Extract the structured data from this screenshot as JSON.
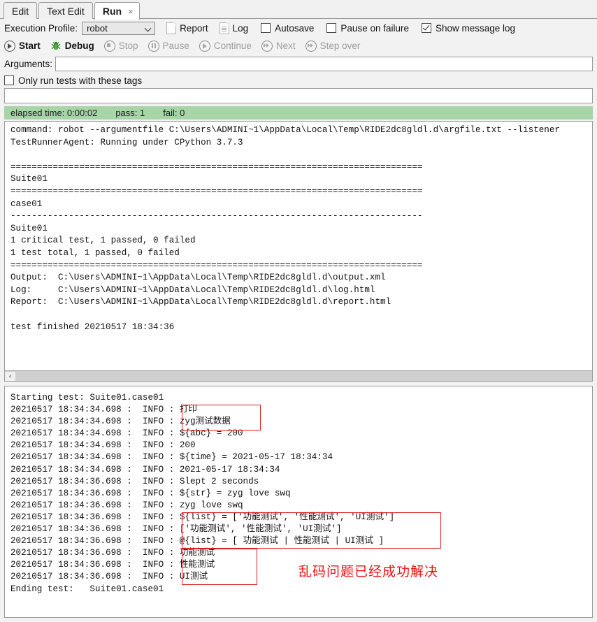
{
  "tabs": [
    {
      "label": "Edit",
      "active": false
    },
    {
      "label": "Text Edit",
      "active": false
    },
    {
      "label": "Run",
      "active": true,
      "close": "×"
    }
  ],
  "toolbar": {
    "execution_profile_label": "Execution Profile:",
    "profile_value": "robot",
    "report_label": "Report",
    "log_label": "Log",
    "autosave_label": "Autosave",
    "autosave_checked": false,
    "pause_on_failure_label": "Pause on failure",
    "pause_on_failure_checked": false,
    "show_message_log_label": "Show message log",
    "show_message_log_checked": true
  },
  "run_controls": [
    {
      "label": "Start",
      "enabled": true,
      "icon": "play-icon"
    },
    {
      "label": "Debug",
      "enabled": true,
      "icon": "bug-icon"
    },
    {
      "label": "Stop",
      "enabled": false,
      "icon": "stop-icon"
    },
    {
      "label": "Pause",
      "enabled": false,
      "icon": "pause-icon"
    },
    {
      "label": "Continue",
      "enabled": false,
      "icon": "play-icon"
    },
    {
      "label": "Next",
      "enabled": false,
      "icon": "next-icon"
    },
    {
      "label": "Step over",
      "enabled": false,
      "icon": "step-over-icon"
    }
  ],
  "arguments": {
    "label": "Arguments:",
    "value": "",
    "placeholder": ""
  },
  "tags": {
    "label": "Only run tests with these tags",
    "checked": false,
    "value": "",
    "placeholder": ""
  },
  "status": {
    "elapsed": "elapsed time: 0:00:02",
    "pass": "pass: 1",
    "fail": "fail: 0",
    "background_color": "#a8d5a8"
  },
  "console": {
    "lines": [
      "command: robot --argumentfile C:\\Users\\ADMINI~1\\AppData\\Local\\Temp\\RIDE2dc8gldl.d\\argfile.txt --listener",
      "TestRunnerAgent: Running under CPython 3.7.3",
      "",
      "==============================================================================",
      "Suite01",
      "==============================================================================",
      "case01",
      "------------------------------------------------------------------------------",
      "Suite01",
      "1 critical test, 1 passed, 0 failed",
      "1 test total, 1 passed, 0 failed",
      "==============================================================================",
      "Output:  C:\\Users\\ADMINI~1\\AppData\\Local\\Temp\\RIDE2dc8gldl.d\\output.xml",
      "Log:     C:\\Users\\ADMINI~1\\AppData\\Local\\Temp\\RIDE2dc8gldl.d\\log.html",
      "Report:  C:\\Users\\ADMINI~1\\AppData\\Local\\Temp\\RIDE2dc8gldl.d\\report.html",
      "",
      "test finished 20210517 18:34:36"
    ]
  },
  "message_log": {
    "lines": [
      "Starting test: Suite01.case01",
      "20210517 18:34:34.698 :  INFO : 打印",
      "20210517 18:34:34.698 :  INFO : zyg测试数据",
      "20210517 18:34:34.698 :  INFO : ${abc} = 200",
      "20210517 18:34:34.698 :  INFO : 200",
      "20210517 18:34:34.698 :  INFO : ${time} = 2021-05-17 18:34:34",
      "20210517 18:34:34.698 :  INFO : 2021-05-17 18:34:34",
      "20210517 18:34:36.698 :  INFO : Slept 2 seconds",
      "20210517 18:34:36.698 :  INFO : ${str} = zyg love swq",
      "20210517 18:34:36.698 :  INFO : zyg love swq",
      "20210517 18:34:36.698 :  INFO : ${list} = ['功能测试', '性能测试', 'UI测试']",
      "20210517 18:34:36.698 :  INFO : ['功能测试', '性能测试', 'UI测试']",
      "20210517 18:34:36.698 :  INFO : @{list} = [ 功能测试 | 性能测试 | UI测试 ]",
      "20210517 18:34:36.698 :  INFO : 功能测试",
      "20210517 18:34:36.698 :  INFO : 性能测试",
      "20210517 18:34:36.698 :  INFO : UI测试",
      "Ending test:   Suite01.case01"
    ],
    "annotation": "乱码问题已经成功解决",
    "annotation_color": "#ee1111",
    "highlight_color": "#e02020"
  },
  "scrollbar": {
    "left_arrow": "‹"
  }
}
